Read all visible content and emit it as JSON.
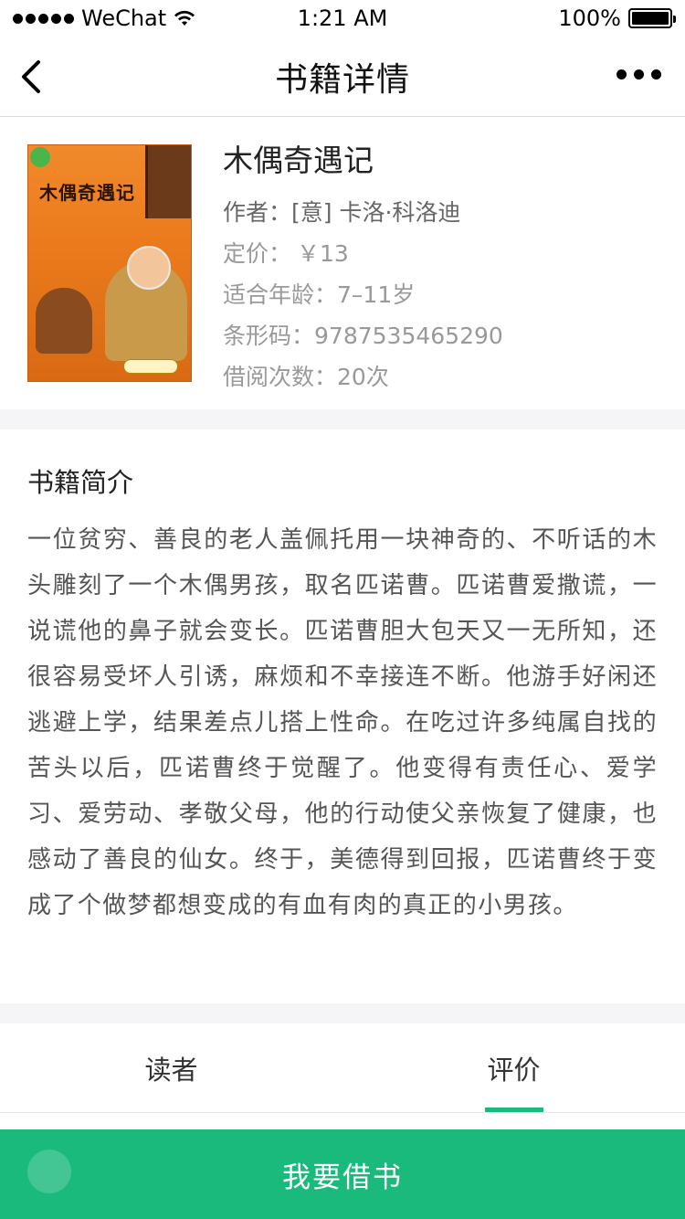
{
  "status_bar": {
    "carrier": "WeChat",
    "time": "1:21 AM",
    "battery": "100%"
  },
  "nav": {
    "title": "书籍详情"
  },
  "book": {
    "title": "木偶奇遇记",
    "author_label": "作者：",
    "author": "[意] 卡洛·科洛迪",
    "price_label": "定价：",
    "price": "￥13",
    "age_label": "适合年龄：",
    "age": "7–11岁",
    "barcode_label": "条形码：",
    "barcode": "9787535465290",
    "borrow_count_label": "借阅次数：",
    "borrow_count": "20次",
    "cover_title": "木偶奇遇记"
  },
  "intro": {
    "title": "书籍简介",
    "text": "一位贫穷、善良的老人盖佩托用一块神奇的、不听话的木头雕刻了一个木偶男孩，取名匹诺曹。匹诺曹爱撒谎，一说谎他的鼻子就会变长。匹诺曹胆大包天又一无所知，还很容易受坏人引诱，麻烦和不幸接连不断。他游手好闲还逃避上学，结果差点儿搭上性命。在吃过许多纯属自找的苦头以后，匹诺曹终于觉醒了。他变得有责任心、爱学习、爱劳动、孝敬父母，他的行动使父亲恢复了健康，也感动了善良的仙女。终于，美德得到回报，匹诺曹终于变成了个做梦都想变成的有血有肉的真正的小男孩。"
  },
  "tabs": [
    {
      "label": "读者"
    },
    {
      "label": "评价"
    }
  ],
  "borrow_button": {
    "label": "我要借书"
  },
  "colors": {
    "accent": "#1aba7c",
    "cover": "#ec7b1c"
  }
}
